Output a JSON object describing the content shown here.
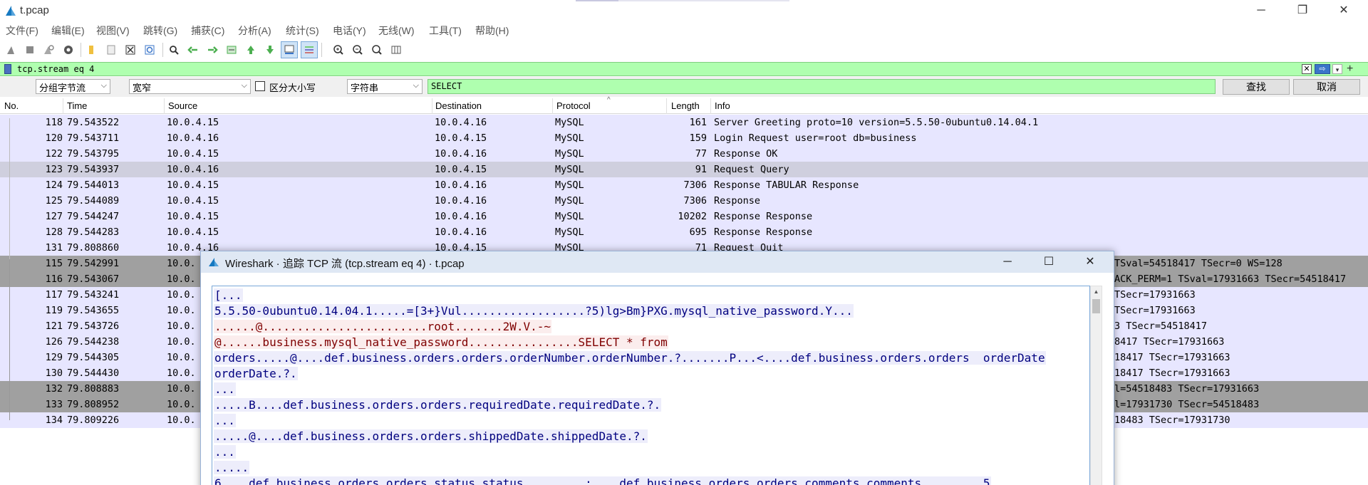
{
  "window": {
    "title": "t.pcap",
    "minimize": "─",
    "maximize": "❐",
    "close": "✕"
  },
  "menu": [
    "文件(F)",
    "编辑(E)",
    "视图(V)",
    "跳转(G)",
    "捕获(C)",
    "分析(A)",
    "统计(S)",
    "电话(Y)",
    "无线(W)",
    "工具(T)",
    "帮助(H)"
  ],
  "toolbar": {
    "icons": [
      "shark-fin-start-icon",
      "stop-icon",
      "restart-icon",
      "options-gear-icon",
      "open-folder-icon",
      "file-icon",
      "close-file-icon",
      "reload-icon",
      "find-icon",
      "go-back-icon",
      "go-forward-icon",
      "go-to-packet-icon",
      "first-packet-icon",
      "last-packet-icon",
      "autoscroll-icon",
      "colorize-icon",
      "zoom-in-icon",
      "zoom-out-icon",
      "normal-size-icon",
      "resize-columns-icon"
    ]
  },
  "filter": {
    "text": "tcp.stream eq 4",
    "clear": "✕",
    "apply": "⇨",
    "dropdown": "▾",
    "add": "+"
  },
  "find": {
    "scope": "分组字节流",
    "width": "宽窄",
    "case_label": "区分大小写",
    "mode": "字符串",
    "value": "SELECT",
    "find_button": "查找",
    "cancel_button": "取消"
  },
  "columns": [
    "No.",
    "Time",
    "Source",
    "Destination",
    "Protocol",
    "Length",
    "Info"
  ],
  "packets": [
    {
      "no": "118",
      "time": "79.543522",
      "src": "10.0.4.15",
      "dst": "10.0.4.16",
      "proto": "MySQL",
      "len": "161",
      "info": "Server Greeting  proto=10 version=5.5.50-0ubuntu0.14.04.1",
      "style": "lav"
    },
    {
      "no": "120",
      "time": "79.543711",
      "src": "10.0.4.16",
      "dst": "10.0.4.15",
      "proto": "MySQL",
      "len": "159",
      "info": "Login Request user=root db=business",
      "style": "lav"
    },
    {
      "no": "122",
      "time": "79.543795",
      "src": "10.0.4.15",
      "dst": "10.0.4.16",
      "proto": "MySQL",
      "len": "77",
      "info": "Response  OK",
      "style": "lav"
    },
    {
      "no": "123",
      "time": "79.543937",
      "src": "10.0.4.16",
      "dst": "10.0.4.15",
      "proto": "MySQL",
      "len": "91",
      "info": "Request Query",
      "style": "sel"
    },
    {
      "no": "124",
      "time": "79.544013",
      "src": "10.0.4.15",
      "dst": "10.0.4.16",
      "proto": "MySQL",
      "len": "7306",
      "info": "Response TABULAR Response",
      "style": "lav"
    },
    {
      "no": "125",
      "time": "79.544089",
      "src": "10.0.4.15",
      "dst": "10.0.4.16",
      "proto": "MySQL",
      "len": "7306",
      "info": "Response",
      "style": "lav"
    },
    {
      "no": "127",
      "time": "79.544247",
      "src": "10.0.4.15",
      "dst": "10.0.4.16",
      "proto": "MySQL",
      "len": "10202",
      "info": "Response Response",
      "style": "lav"
    },
    {
      "no": "128",
      "time": "79.544283",
      "src": "10.0.4.15",
      "dst": "10.0.4.16",
      "proto": "MySQL",
      "len": "695",
      "info": "Response Response",
      "style": "lav"
    },
    {
      "no": "131",
      "time": "79.808860",
      "src": "10.0.4.16",
      "dst": "10.0.4.15",
      "proto": "MySQL",
      "len": "71",
      "info": "Request Quit",
      "style": "lav"
    },
    {
      "no": "115",
      "time": "79.542991",
      "src": "10.0.",
      "dst": "",
      "proto": "",
      "len": "",
      "info": "TSval=54518417 TSecr=0 WS=128",
      "style": "gray"
    },
    {
      "no": "116",
      "time": "79.543067",
      "src": "10.0.",
      "dst": "",
      "proto": "",
      "len": "",
      "info": "ACK_PERM=1 TSval=17931663 TSecr=54518417",
      "style": "gray"
    },
    {
      "no": "117",
      "time": "79.543241",
      "src": "10.0.",
      "dst": "",
      "proto": "",
      "len": "",
      "info": "TSecr=17931663",
      "style": "lav"
    },
    {
      "no": "119",
      "time": "79.543655",
      "src": "10.0.",
      "dst": "",
      "proto": "",
      "len": "",
      "info": "TSecr=17931663",
      "style": "lav"
    },
    {
      "no": "121",
      "time": "79.543726",
      "src": "10.0.",
      "dst": "",
      "proto": "",
      "len": "",
      "info": "3 TSecr=54518417",
      "style": "lav"
    },
    {
      "no": "126",
      "time": "79.544238",
      "src": "10.0.",
      "dst": "",
      "proto": "",
      "len": "",
      "info": "8417 TSecr=17931663",
      "style": "lav"
    },
    {
      "no": "129",
      "time": "79.544305",
      "src": "10.0.",
      "dst": "",
      "proto": "",
      "len": "",
      "info": "18417 TSecr=17931663",
      "style": "lav"
    },
    {
      "no": "130",
      "time": "79.544430",
      "src": "10.0.",
      "dst": "",
      "proto": "",
      "len": "",
      "info": "18417 TSecr=17931663",
      "style": "lav"
    },
    {
      "no": "132",
      "time": "79.808883",
      "src": "10.0.",
      "dst": "",
      "proto": "",
      "len": "",
      "info": "l=54518483 TSecr=17931663",
      "style": "gray"
    },
    {
      "no": "133",
      "time": "79.808952",
      "src": "10.0.",
      "dst": "",
      "proto": "",
      "len": "",
      "info": "l=17931730 TSecr=54518483",
      "style": "gray"
    },
    {
      "no": "134",
      "time": "79.809226",
      "src": "10.0.",
      "dst": "",
      "proto": "",
      "len": "",
      "info": "18483 TSecr=17931730",
      "style": "lav"
    }
  ],
  "dialog": {
    "title": "Wireshark · 追踪 TCP 流 (tcp.stream eq 4) · t.pcap",
    "minimize": "─",
    "maximize": "☐",
    "close": "✕",
    "lines": [
      {
        "text": "[...",
        "dir": "srv"
      },
      {
        "text": "5.5.50-0ubuntu0.14.04.1.....=[3+}Vul..................?5)lg>Bm}PXG.mysql_native_password.Y...",
        "dir": "srv"
      },
      {
        "text": "......@........................root.......2W.V.-~",
        "dir": "cli"
      },
      {
        "text": "@......business.mysql_native_password................SELECT * from",
        "dir": "cli"
      },
      {
        "text": "orders.....@....def.business.orders.orders.orderNumber.orderNumber.?.......P...<....def.business.orders.orders  orderDate",
        "dir": "srv"
      },
      {
        "text": "orderDate.?.",
        "dir": "srv"
      },
      {
        "text": "...",
        "dir": "srv"
      },
      {
        "text": ".....B....def.business.orders.orders.requiredDate.requiredDate.?.",
        "dir": "srv"
      },
      {
        "text": "...",
        "dir": "srv"
      },
      {
        "text": ".....@....def.business.orders.orders.shippedDate.shippedDate.?.",
        "dir": "srv"
      },
      {
        "text": "...",
        "dir": "srv"
      },
      {
        "text": ".....",
        "dir": "srv"
      },
      {
        "text": "6....def.business.orders.orders.status.status.........:....def.business.orders.orders.comments.comments.........5",
        "dir": "srv"
      }
    ],
    "scroll_up": "▲"
  },
  "colors": {
    "filter_bg": "#afffaf",
    "row_lavender": "#e7e6ff",
    "row_selected": "#cfcfde",
    "row_gray": "#a0a0a0",
    "client_text": "#7f0000",
    "server_text": "#00007f"
  }
}
